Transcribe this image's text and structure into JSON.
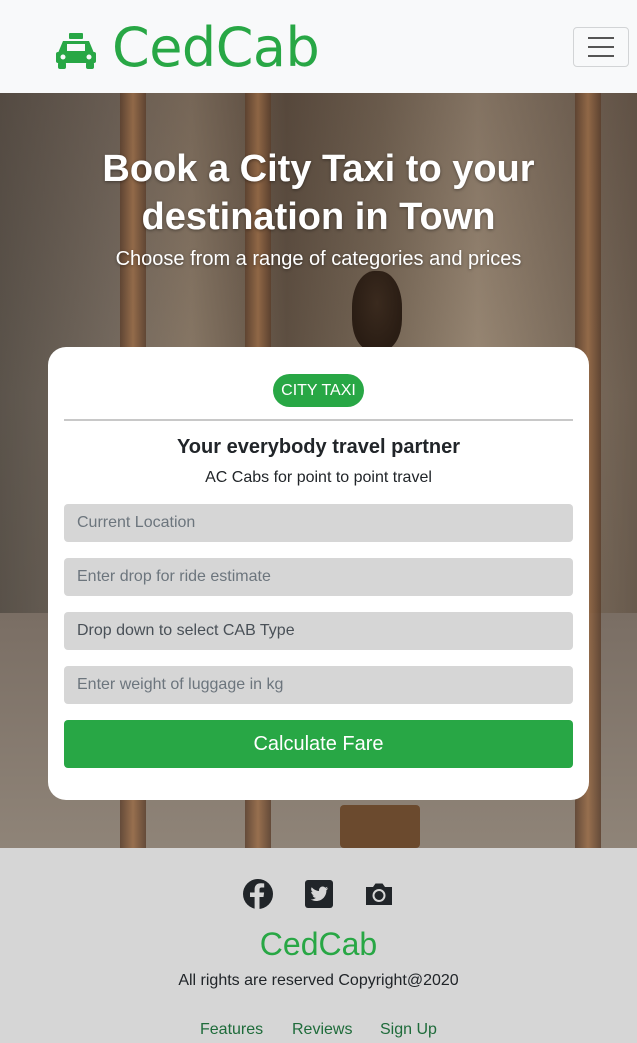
{
  "navbar": {
    "brand": "CedCab",
    "brand_icon": "taxi-icon",
    "menu_icon": "hamburger-menu-icon"
  },
  "hero": {
    "title": "Book a City Taxi to your destination in Town",
    "subtitle": "Choose from a range of categories and prices"
  },
  "booking_card": {
    "category_pill": "CITY TAXI",
    "heading": "Your everybody travel partner",
    "tagline": "AC Cabs for point to point travel",
    "pickup_placeholder": "Current Location",
    "drop_placeholder": "Enter drop for ride estimate",
    "cab_type_selected": "Drop down to select CAB Type",
    "luggage_placeholder": "Enter weight of luggage in kg",
    "submit_label": "Calculate Fare"
  },
  "footer": {
    "social_icons": [
      "facebook-icon",
      "twitter-icon",
      "camera-icon"
    ],
    "brand": "CedCab",
    "copyright": "All rights are reserved Copyright@2020",
    "links": [
      "Features",
      "Reviews",
      "Sign Up"
    ]
  },
  "colors": {
    "accent": "#28a745",
    "navbar_bg": "#f8f9fa",
    "footer_bg": "#d6d6d6",
    "field_bg": "#d6d6d6"
  }
}
